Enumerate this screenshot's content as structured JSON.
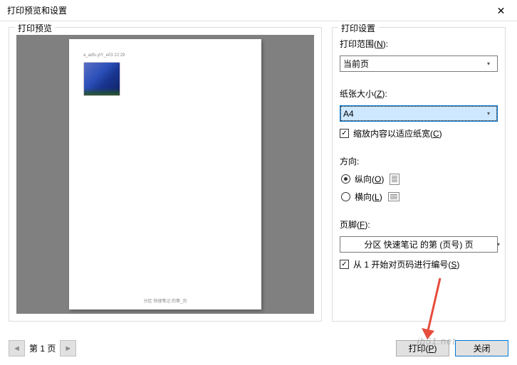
{
  "window": {
    "title": "打印预览和设置",
    "close": "✕"
  },
  "preview": {
    "group_label": "打印预览",
    "page_header": "a_adfs.ytY_e03     22:29",
    "page_footer": "分区 快速笔记 的第_页"
  },
  "settings": {
    "group_label": "打印设置",
    "range_label_pre": "打印范围(",
    "range_label_key": "N",
    "range_label_post": "):",
    "range_value": "当前页",
    "size_label_pre": "纸张大小(",
    "size_label_key": "Z",
    "size_label_post": "):",
    "size_value": "A4",
    "fit_label_pre": "缩放内容以适应纸宽(",
    "fit_label_key": "C",
    "fit_label_post": ")",
    "orient_label": "方向:",
    "portrait_pre": "纵向(",
    "portrait_key": "O",
    "portrait_post": ")",
    "landscape_pre": "横向(",
    "landscape_key": "L",
    "landscape_post": ")",
    "footer_label_pre": "页脚(",
    "footer_label_key": "F",
    "footer_label_post": "):",
    "footer_value": "分区 快速笔记 的第 (页号) 页",
    "startnum_pre": "从 1 开始对页码进行编号(",
    "startnum_key": "S",
    "startnum_post": ")"
  },
  "pager": {
    "prev": "◄",
    "label": "第 1 页",
    "next": "►"
  },
  "buttons": {
    "print_pre": "打印(",
    "print_key": "P",
    "print_post": ")",
    "close": "关闭"
  },
  "watermark": "jb51.net"
}
